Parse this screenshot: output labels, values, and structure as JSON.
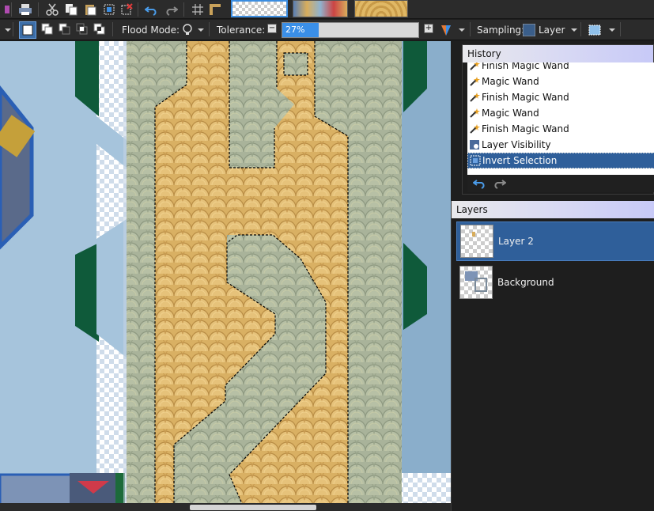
{
  "toolbar2": {
    "flood_mode_label": "Flood Mode:",
    "tolerance_label": "Tolerance:",
    "tolerance_value": "27%",
    "tolerance_fraction": 0.27,
    "sampling_label": "Sampling:",
    "sampling_value": "Layer"
  },
  "history": {
    "title": "History",
    "items": [
      {
        "label": "Finish Magic Wand",
        "icon": "magic-wand-icon"
      },
      {
        "label": "Magic Wand",
        "icon": "magic-wand-icon"
      },
      {
        "label": "Finish Magic Wand",
        "icon": "magic-wand-icon"
      },
      {
        "label": "Magic Wand",
        "icon": "magic-wand-icon"
      },
      {
        "label": "Finish Magic Wand",
        "icon": "magic-wand-icon"
      },
      {
        "label": "Layer Visibility",
        "icon": "layer-visibility-icon"
      },
      {
        "label": "Invert Selection",
        "icon": "invert-selection-icon"
      }
    ],
    "selected_index": 6
  },
  "layers": {
    "title": "Layers",
    "items": [
      {
        "name": "Layer 2",
        "selected": true
      },
      {
        "name": "Background",
        "selected": false
      }
    ]
  },
  "colors": {
    "accent": "#3a8fe8",
    "selection": "#2f5f9a",
    "canvas_bg": "#a6c4dc",
    "mosaic_gold": "#d8ad5c",
    "mosaic_green": "#a7b39a",
    "dark_green": "#0f5a3a"
  }
}
